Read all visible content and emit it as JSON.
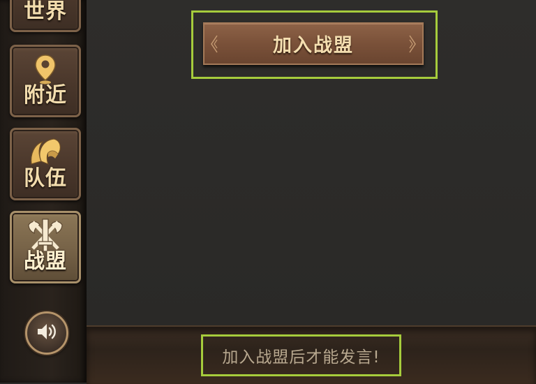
{
  "sidebar": {
    "tabs": [
      {
        "id": "world",
        "label": "世界",
        "icon": "globe-icon",
        "active": false
      },
      {
        "id": "nearby",
        "label": "附近",
        "icon": "location-pin-icon",
        "active": false
      },
      {
        "id": "team",
        "label": "队伍",
        "icon": "helmet-icon",
        "active": false
      },
      {
        "id": "alliance",
        "label": "战盟",
        "icon": "crossed-swords-icon",
        "active": true
      }
    ],
    "sound_icon": "speaker-icon"
  },
  "main": {
    "join_button_label": "加入战盟"
  },
  "chat": {
    "hint": "加入战盟后才能发言!"
  },
  "colors": {
    "highlight": "#a6cc3c",
    "tab_label": "#f3ddae",
    "button": "#7a5139"
  }
}
